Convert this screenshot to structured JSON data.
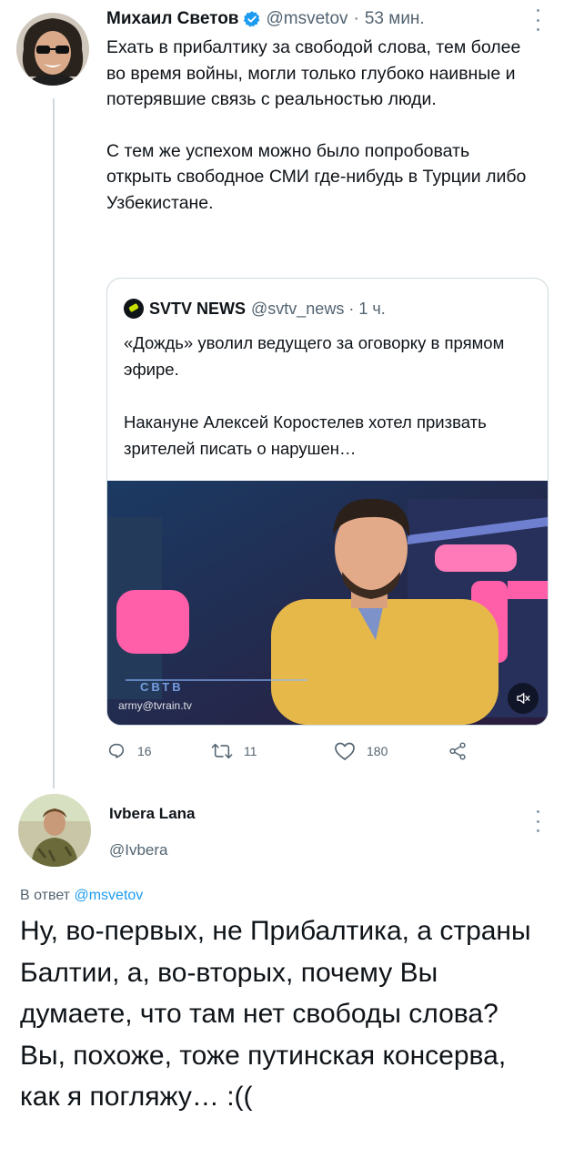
{
  "tweet": {
    "author_name": "Михаил Светов",
    "handle": "@msvetov",
    "separator": "·",
    "time": "53 мин.",
    "paragraphs": [
      "Ехать в прибалтику за свободой слова, тем более во время войны, могли только глубоко наивные и потерявшие связь с реальностью люди.",
      "С тем же успехом можно было попробовать открыть свободное СМИ где-нибудь в Турции либо Узбекистане."
    ],
    "quote": {
      "source_name": "SVTV NEWS",
      "handle": "@svtv_news",
      "separator": "·",
      "time": "1 ч.",
      "paragraphs": [
        "«Дождь» уволил ведущего за оговорку в прямом эфире.",
        "Накануне Алексей Коростелев хотел призвать зрителей писать о нарушен…"
      ],
      "video_watermark": "army@tvrain.tv",
      "video_logo": "СВТВ"
    },
    "stats": {
      "replies": "16",
      "retweets": "11",
      "likes": "180"
    }
  },
  "reply": {
    "author_name": "Ivbera Lana",
    "handle": "@Ivbera",
    "reply_prefix": "В ответ",
    "reply_to_handle": "@msvetov",
    "text": "Ну, во-первых, не Прибалтика, а страны Балтии, а, во-вторых, почему Вы думаете, что там нет свободы слова? Вы, похоже, тоже путинская консерва, как  я погляжу… :(("
  },
  "icons": {
    "verified": "verified-badge-icon",
    "more": "more-options-icon",
    "reply": "reply-icon",
    "retweet": "retweet-icon",
    "like": "like-icon",
    "share": "share-icon",
    "mute": "muted-speaker-icon"
  },
  "colors": {
    "accent": "#1d9bf0",
    "muted_text": "#536471",
    "border": "#cfd9de"
  }
}
